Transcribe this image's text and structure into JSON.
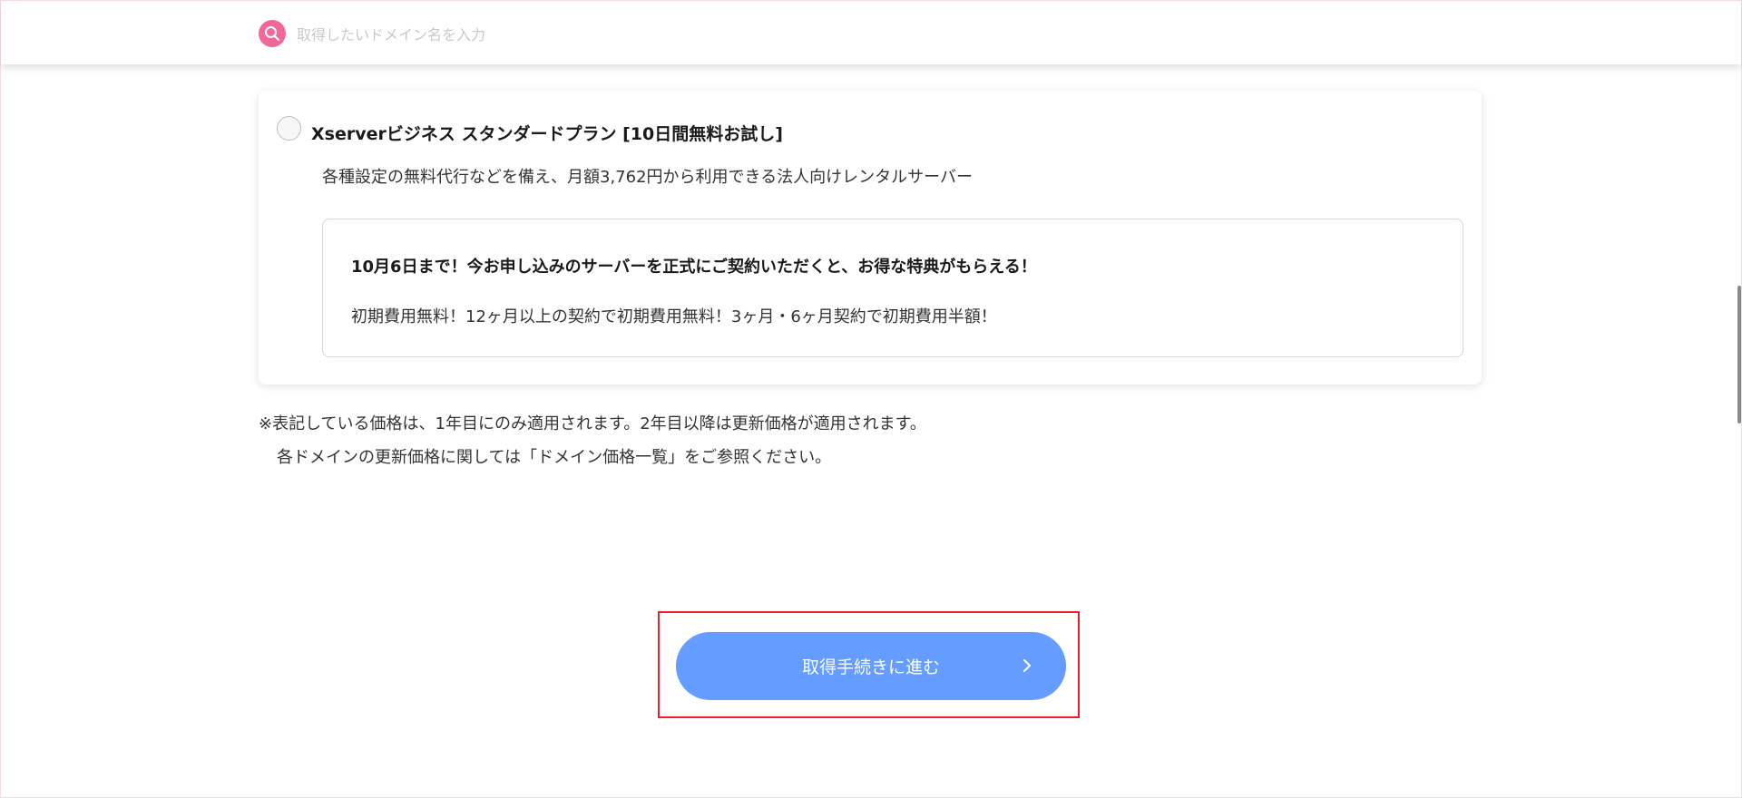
{
  "search": {
    "placeholder": "取得したいドメイン名を入力",
    "value": ""
  },
  "plan": {
    "title": "Xserverビジネス スタンダードプラン [10日間無料お試し]",
    "description": "各種設定の無料代行などを備え、月額3,762円から利用できる法人向けレンタルサーバー",
    "selected": false,
    "promo": {
      "title": "10月6日まで！今お申し込みのサーバーを正式にご契約いただくと、お得な特典がもらえる！",
      "text": "初期費用無料！12ヶ月以上の契約で初期費用無料！3ヶ月・6ヶ月契約で初期費用半額！"
    }
  },
  "notes": {
    "line1": "※表記している価格は、1年目にのみ適用されます。2年目以降は更新価格が適用されます。",
    "line2": "各ドメインの更新価格に関しては「ドメイン価格一覧」をご参照ください。"
  },
  "actions": {
    "proceed_label": "取得手続きに進む"
  },
  "icons": {
    "search": "search-icon",
    "proceed": "chevron-right-icon"
  },
  "colors": {
    "search_icon_bg": "#f0679a",
    "button_bg": "#659cff",
    "highlight_border": "#e8202a"
  }
}
